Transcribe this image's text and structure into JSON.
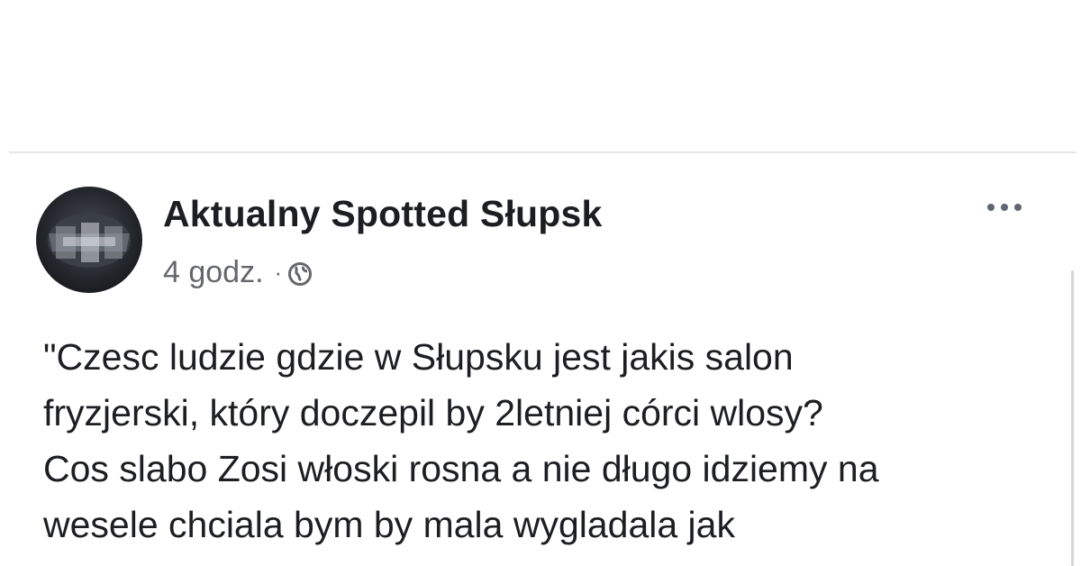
{
  "post": {
    "author": "Aktualny Spotted Słupsk",
    "time": "4 godz.",
    "separator": "·",
    "audience_icon": "globe-icon",
    "menu_icon": "more-options-icon",
    "text_lines": [
      "\"Czesc ludzie gdzie w Słupsku jest jakis salon",
      "fryzjerski, który doczepil by 2letniej córci wlosy?",
      "Cos slabo Zosi włoski rosna a nie długo idziemy na",
      "wesele chciala bym by mala wygladala jak"
    ]
  },
  "colors": {
    "name": "#1c1e21",
    "meta": "#65676b",
    "divider": "#e4e6ea"
  }
}
